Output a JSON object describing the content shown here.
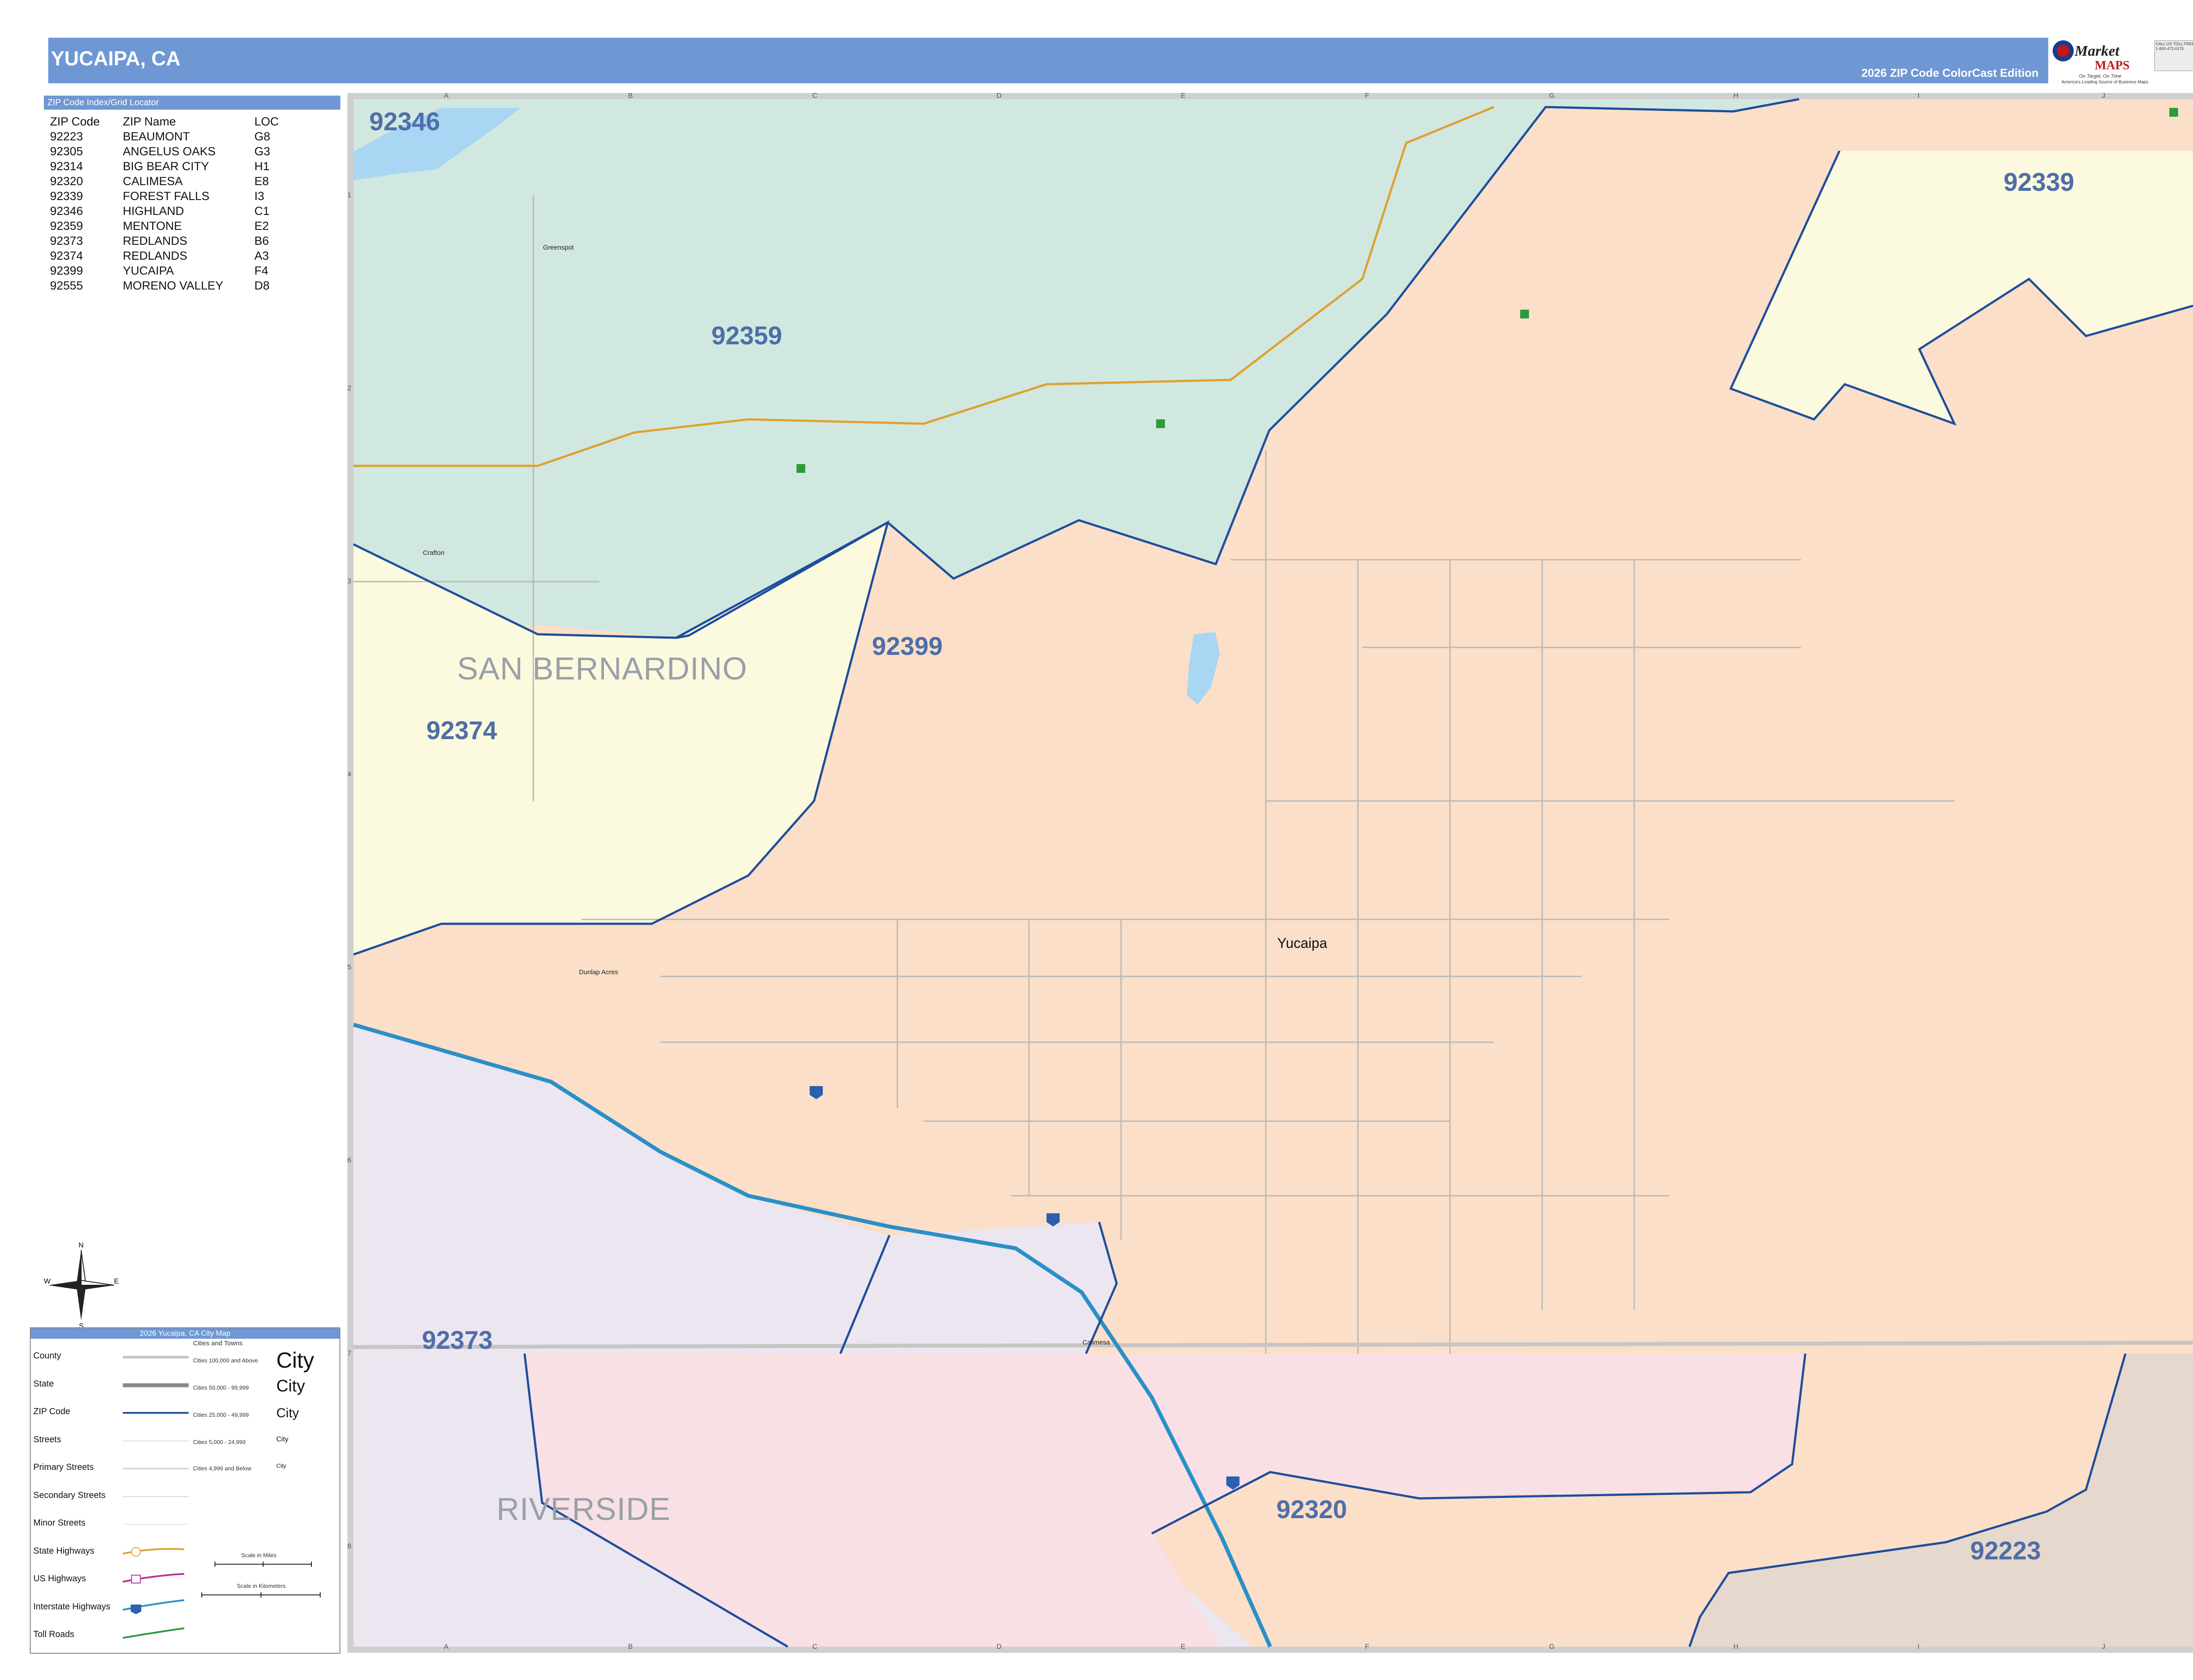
{
  "header": {
    "title": "YUCAIPA, CA",
    "edition": "2026 ZIP Code ColorCast Edition"
  },
  "logo": {
    "brand_top": "Market",
    "brand_bottom": "MAPS",
    "tagline": "On Target, On Time",
    "tagline2": "America's Leading Source of Business Maps",
    "phone_text": "CALL US TOLL FREE 1-800-472-0175"
  },
  "zip_index": {
    "header": "ZIP Code Index/Grid Locator",
    "columns": [
      "ZIP Code",
      "ZIP Name",
      "LOC"
    ],
    "rows": [
      [
        "92223",
        "BEAUMONT",
        "G8"
      ],
      [
        "92305",
        "ANGELUS OAKS",
        "G3"
      ],
      [
        "92314",
        "BIG BEAR CITY",
        "H1"
      ],
      [
        "92320",
        "CALIMESA",
        "E8"
      ],
      [
        "92339",
        "FOREST FALLS",
        "I3"
      ],
      [
        "92346",
        "HIGHLAND",
        "C1"
      ],
      [
        "92359",
        "MENTONE",
        "E2"
      ],
      [
        "92373",
        "REDLANDS",
        "B6"
      ],
      [
        "92374",
        "REDLANDS",
        "A3"
      ],
      [
        "92399",
        "YUCAIPA",
        "F4"
      ],
      [
        "92555",
        "MORENO VALLEY",
        "D8"
      ]
    ]
  },
  "compass": {
    "n": "N",
    "s": "S",
    "e": "E",
    "w": "W"
  },
  "legend": {
    "title": "2026 Yucaipa, CA City Map",
    "cities_header": "Cities and Towns",
    "items": [
      "County",
      "State",
      "ZIP Code",
      "Streets",
      "Primary Streets",
      "Secondary Streets",
      "Minor Streets",
      "State Highways",
      "US Highways",
      "Interstate Highways",
      "Toll Roads"
    ],
    "city_tiers": [
      "Cities 100,000 and Above",
      "Cities 50,000 - 99,999",
      "Cities 25,000 - 49,999",
      "Cities 5,000 - 24,999",
      "Cities 4,999 and Below"
    ],
    "city_sample": "City",
    "scale_miles": "Scale in Miles",
    "scale_km": "Scale in Kilometers",
    "colors": {
      "county": "#c6c6c6",
      "state": "#8a8a8a",
      "zip": "#1f4e9c",
      "state_hwy": "#e0a030",
      "us_hwy": "#c0309a",
      "interstate": "#2b8fc7",
      "toll": "#2e9a3e"
    }
  },
  "map": {
    "colors": {
      "z92399": "#fbdfc8",
      "z92359": "#d0e8e0",
      "z92374": "#fcfade",
      "z92339": "#fcfade",
      "z92373": "#ebe6f0",
      "z92320": "#f8e0e4",
      "z92223": "#e6d8cc",
      "water": "#a9d6f2",
      "border": "#1f4e9c"
    },
    "zip_labels": [
      "92346",
      "92359",
      "92339",
      "92399",
      "92374",
      "92373",
      "92320",
      "92223"
    ],
    "county_labels": [
      "SAN BERNARDINO",
      "RIVERSIDE"
    ],
    "city_label": "Yucaipa",
    "place_labels": [
      "Greenspot",
      "Crafton",
      "Dunlap Acres",
      "Calimesa"
    ],
    "grid_cols": [
      "A",
      "B",
      "C",
      "D",
      "E",
      "F",
      "G",
      "H",
      "I",
      "J"
    ],
    "grid_rows": [
      "1",
      "2",
      "3",
      "4",
      "5",
      "6",
      "7",
      "8"
    ]
  }
}
